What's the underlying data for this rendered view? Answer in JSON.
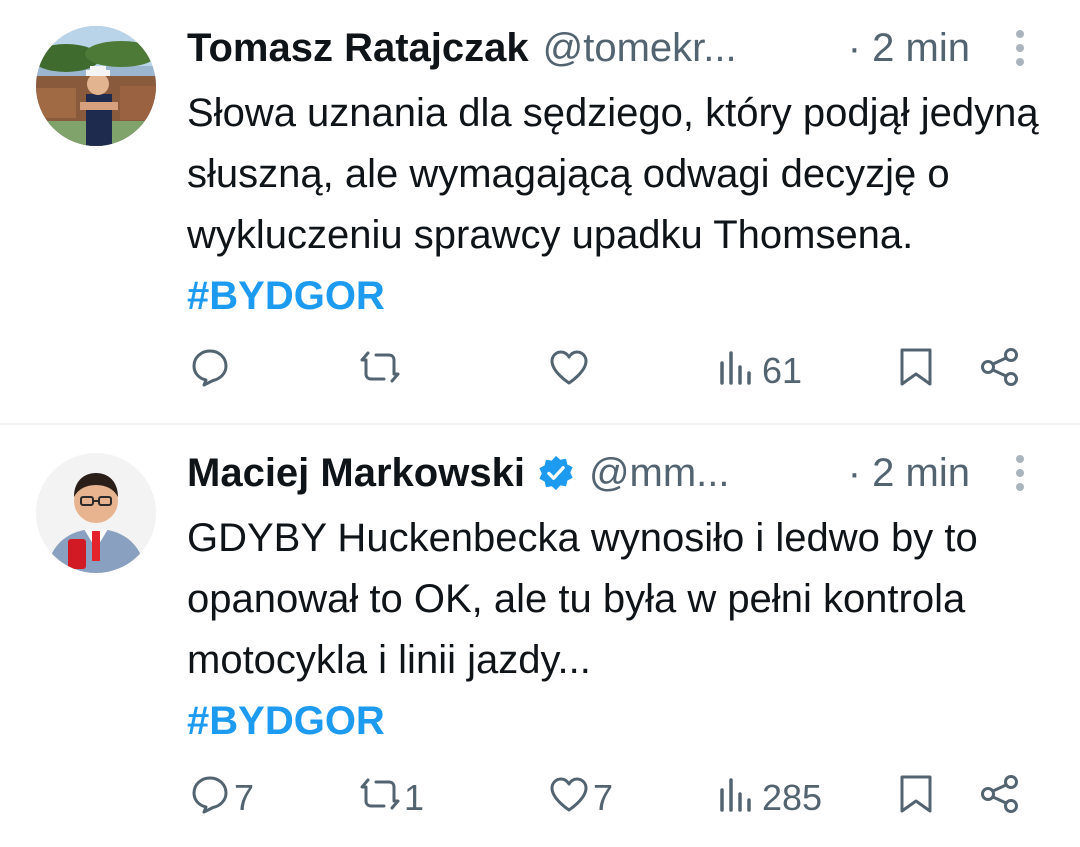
{
  "tweets": [
    {
      "author_name": "Tomasz Ratajczak",
      "handle": "@tomekr...",
      "time": "· 2 min",
      "verified": false,
      "text": "Słowa uznania dla sędziego, który podjął jedyną słuszną, ale wymagającą odwagi decyzję o wykluczeniu sprawcy upadku Thomsena. ",
      "hashtag": "#BYDGOR",
      "replies": "",
      "retweets": "",
      "likes": "",
      "views": "61"
    },
    {
      "author_name": "Maciej Markowski",
      "handle": "@mm...",
      "time": "· 2 min",
      "verified": true,
      "text": "GDYBY Huckenbecka wynosiło i ledwo by to opanował to OK, ale tu była w pełni kontrola motocykla i linii jazdy...",
      "hashtag": "#BYDGOR",
      "replies": "7",
      "retweets": "1",
      "likes": "7",
      "views": "285"
    }
  ],
  "colors": {
    "text": "#0f1419",
    "secondary": "#536471",
    "accent": "#1d9bf0",
    "divider": "#eff3f4"
  },
  "icons": [
    "reply-icon",
    "retweet-icon",
    "like-icon",
    "views-icon",
    "bookmark-icon",
    "share-icon",
    "more-icon",
    "verified-badge-icon"
  ]
}
